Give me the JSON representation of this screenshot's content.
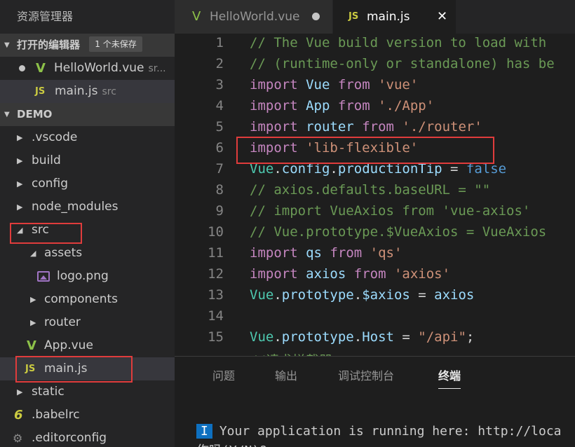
{
  "explorer": {
    "title": "资源管理器",
    "open_editors": {
      "label": "打开的编辑器",
      "badge": "1 个未保存",
      "items": [
        {
          "name": "HelloWorld.vue",
          "desc": "sr..."
        },
        {
          "name": "main.js",
          "desc": "src"
        }
      ]
    },
    "project": {
      "label": "DEMO",
      "items": [
        {
          "name": ".vscode"
        },
        {
          "name": "build"
        },
        {
          "name": "config"
        },
        {
          "name": "node_modules"
        },
        {
          "name": "src"
        },
        {
          "name": "assets"
        },
        {
          "name": "logo.png"
        },
        {
          "name": "components"
        },
        {
          "name": "router"
        },
        {
          "name": "App.vue"
        },
        {
          "name": "main.js"
        },
        {
          "name": "static"
        },
        {
          "name": ".babelrc"
        },
        {
          "name": ".editorconfig"
        }
      ]
    }
  },
  "tabs": [
    {
      "label": "HelloWorld.vue",
      "icon": "vue-icon"
    },
    {
      "label": "main.js",
      "icon": "js-icon",
      "close": "✕"
    }
  ],
  "icons": {
    "js": "JS",
    "vue": "V",
    "babel": "6",
    "gear": "⚙"
  },
  "editor": {
    "lines": [
      {
        "n": "1",
        "parts": [
          [
            "c-com",
            "// The Vue build version to load with"
          ]
        ]
      },
      {
        "n": "2",
        "parts": [
          [
            "c-com",
            "// (runtime-only or standalone) has be"
          ]
        ]
      },
      {
        "n": "3",
        "parts": [
          [
            "c-kw",
            "import"
          ],
          [
            "c-pl",
            " "
          ],
          [
            "c-var",
            "Vue"
          ],
          [
            "c-pl",
            " "
          ],
          [
            "c-kw",
            "from"
          ],
          [
            "c-pl",
            " "
          ],
          [
            "c-str",
            "'vue'"
          ]
        ]
      },
      {
        "n": "4",
        "parts": [
          [
            "c-kw",
            "import"
          ],
          [
            "c-pl",
            " "
          ],
          [
            "c-var",
            "App"
          ],
          [
            "c-pl",
            " "
          ],
          [
            "c-kw",
            "from"
          ],
          [
            "c-pl",
            " "
          ],
          [
            "c-str",
            "'./App'"
          ]
        ]
      },
      {
        "n": "5",
        "parts": [
          [
            "c-kw",
            "import"
          ],
          [
            "c-pl",
            " "
          ],
          [
            "c-var",
            "router"
          ],
          [
            "c-pl",
            " "
          ],
          [
            "c-kw",
            "from"
          ],
          [
            "c-pl",
            " "
          ],
          [
            "c-str",
            "'./router'"
          ]
        ]
      },
      {
        "n": "6",
        "parts": [
          [
            "c-kw",
            "import"
          ],
          [
            "c-pl",
            " "
          ],
          [
            "c-str",
            "'lib-flexible'"
          ]
        ]
      },
      {
        "n": "7",
        "parts": [
          [
            "c-obj",
            "Vue"
          ],
          [
            "c-pl",
            "."
          ],
          [
            "c-var",
            "config"
          ],
          [
            "c-pl",
            "."
          ],
          [
            "c-var",
            "productionTip"
          ],
          [
            "c-pl",
            " = "
          ],
          [
            "c-bool",
            "false"
          ]
        ]
      },
      {
        "n": "8",
        "parts": [
          [
            "c-com",
            "// axios.defaults.baseURL = \"\""
          ]
        ]
      },
      {
        "n": "9",
        "parts": [
          [
            "c-com",
            "// import VueAxios from 'vue-axios'"
          ]
        ]
      },
      {
        "n": "10",
        "parts": [
          [
            "c-com",
            "// Vue.prototype.$VueAxios = VueAxios"
          ]
        ]
      },
      {
        "n": "11",
        "parts": [
          [
            "c-kw",
            "import"
          ],
          [
            "c-pl",
            " "
          ],
          [
            "c-var",
            "qs"
          ],
          [
            "c-pl",
            " "
          ],
          [
            "c-kw",
            "from"
          ],
          [
            "c-pl",
            " "
          ],
          [
            "c-str",
            "'qs'"
          ]
        ]
      },
      {
        "n": "12",
        "parts": [
          [
            "c-kw",
            "import"
          ],
          [
            "c-pl",
            " "
          ],
          [
            "c-var",
            "axios"
          ],
          [
            "c-pl",
            " "
          ],
          [
            "c-kw",
            "from"
          ],
          [
            "c-pl",
            " "
          ],
          [
            "c-str",
            "'axios'"
          ]
        ]
      },
      {
        "n": "13",
        "parts": [
          [
            "c-obj",
            "Vue"
          ],
          [
            "c-pl",
            "."
          ],
          [
            "c-var",
            "prototype"
          ],
          [
            "c-pl",
            "."
          ],
          [
            "c-var",
            "$axios"
          ],
          [
            "c-pl",
            " = "
          ],
          [
            "c-var",
            "axios"
          ]
        ]
      },
      {
        "n": "14",
        "parts": []
      },
      {
        "n": "15",
        "parts": [
          [
            "c-obj",
            "Vue"
          ],
          [
            "c-pl",
            "."
          ],
          [
            "c-var",
            "prototype"
          ],
          [
            "c-pl",
            "."
          ],
          [
            "c-var",
            "Host"
          ],
          [
            "c-pl",
            " = "
          ],
          [
            "c-str",
            "\"/api\""
          ],
          [
            "c-pl",
            ";"
          ]
        ]
      },
      {
        "n": "",
        "parts": [
          [
            "c-com",
            "//请求拦截器"
          ]
        ]
      }
    ]
  },
  "panel": {
    "tabs": [
      "问题",
      "输出",
      "调试控制台",
      "终端"
    ],
    "active_tab": "终端",
    "terminal": {
      "badge": "I",
      "line1": "Your application is running here: http://loca",
      "line2": "作吗(Y/N)?"
    }
  }
}
